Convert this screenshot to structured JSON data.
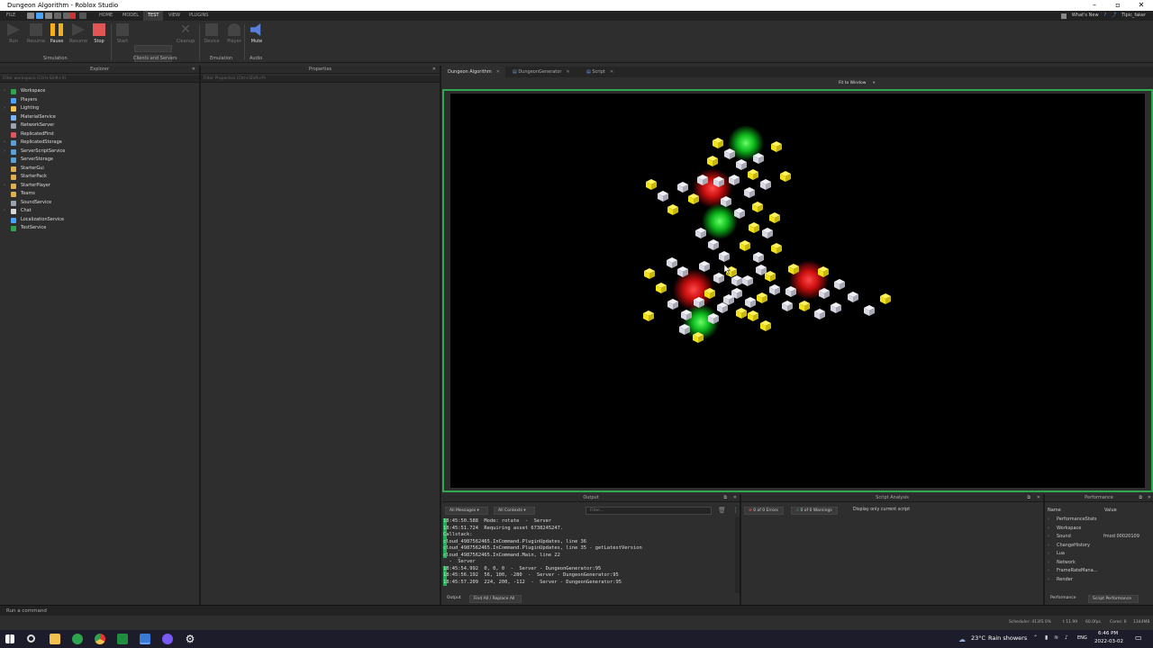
{
  "window": {
    "title": "Dungeon Algorithm - Roblox Studio"
  },
  "menu": {
    "file": "FILE",
    "home": "HOME",
    "model": "MODEL",
    "test": "TEST",
    "view": "VIEW",
    "plugins": "PLUGINS",
    "whats_new": "What's New",
    "user": "Tipic_faker"
  },
  "ribbon": {
    "run": "Run",
    "resume": "Resume",
    "pause": "Pause",
    "play": "Resume",
    "stop": "Stop",
    "start": "Start",
    "cleanup": "Cleanup",
    "device": "Device",
    "player": "Player",
    "mute": "Mute",
    "groups": {
      "simulation": "Simulation",
      "clients": "Clients and Servers",
      "emulation": "Emulation",
      "audio": "Audio"
    }
  },
  "explorer": {
    "title": "Explorer",
    "filter": "Filter workspace (Ctrl+Shift+X)",
    "items": [
      {
        "label": "Workspace",
        "icon": "globe-icon",
        "color": "#2da44e",
        "expand": true
      },
      {
        "label": "Players",
        "icon": "players-icon",
        "color": "#4aa3ff",
        "expand": false
      },
      {
        "label": "Lighting",
        "icon": "lightbulb-icon",
        "color": "#f2c14e",
        "expand": true
      },
      {
        "label": "MaterialService",
        "icon": "material-icon",
        "color": "#7ab6ff",
        "expand": false
      },
      {
        "label": "NetworkServer",
        "icon": "network-icon",
        "color": "#9aa4b1",
        "expand": false
      },
      {
        "label": "ReplicatedFirst",
        "icon": "replicated-first-icon",
        "color": "#e05561",
        "expand": false
      },
      {
        "label": "ReplicatedStorage",
        "icon": "replicated-storage-icon",
        "color": "#5aa0d8",
        "expand": true
      },
      {
        "label": "ServerScriptService",
        "icon": "server-script-icon",
        "color": "#5aa0d8",
        "expand": true
      },
      {
        "label": "ServerStorage",
        "icon": "server-storage-icon",
        "color": "#5aa0d8",
        "expand": false
      },
      {
        "label": "StarterGui",
        "icon": "starter-gui-icon",
        "color": "#e0b050",
        "expand": false
      },
      {
        "label": "StarterPack",
        "icon": "starter-pack-icon",
        "color": "#e0b050",
        "expand": false
      },
      {
        "label": "StarterPlayer",
        "icon": "starter-player-icon",
        "color": "#e0b050",
        "expand": true
      },
      {
        "label": "Teams",
        "icon": "teams-icon",
        "color": "#e0b050",
        "expand": false
      },
      {
        "label": "SoundService",
        "icon": "sound-icon",
        "color": "#9aa4b1",
        "expand": false
      },
      {
        "label": "Chat",
        "icon": "chat-icon",
        "color": "#d8d8d8",
        "expand": true
      },
      {
        "label": "LocalizationService",
        "icon": "localization-icon",
        "color": "#4aa3ff",
        "expand": false
      },
      {
        "label": "TestService",
        "icon": "test-icon",
        "color": "#2da44e",
        "expand": false
      }
    ]
  },
  "properties": {
    "title": "Properties",
    "filter": "Filter Properties (Ctrl+Shift+P)"
  },
  "tabs": [
    {
      "label": "Dungeon Algorithm",
      "icon": "place-icon"
    },
    {
      "label": "DungeonGenerator",
      "icon": "script-icon"
    },
    {
      "label": "Script",
      "icon": "script-icon"
    }
  ],
  "viewport_toolbar": {
    "fit": "Fit to Window"
  },
  "output": {
    "title": "Output",
    "filter_messages": "All Messages",
    "filter_contexts": "All Contexts",
    "filter_placeholder": "Filter...",
    "lines": [
      "18:45:50.588  Mode: rotate  -  Server",
      "18:45:51.724  Requiring asset 6738245247.",
      "Callstack:",
      "cloud_4987562465.InCommand.PluginUpdates, line 36",
      "cloud_4987562465.InCommand.PluginUpdates, line 35 - getLatestVersion",
      "cloud_4987562465.InCommand.Main, line 22",
      "  -  Server",
      "18:45:54.992  0, 0, 0  -  Server - DungeonGenerator:95",
      "18:45:56.192  56, 100, -280  -  Server - DungeonGenerator:95",
      "18:45:57.209  224, 200, -112  -  Server - DungeonGenerator:95"
    ],
    "tab_output": "Output",
    "tab_find": "Find All / Replace All"
  },
  "script_analysis": {
    "title": "Script Analysis",
    "errors": "0 of 0 Errors",
    "warnings": "0 of 0 Warnings",
    "option": "Display only current script"
  },
  "performance": {
    "title": "Performance",
    "col_name": "Name",
    "col_value": "Value",
    "rows": [
      {
        "name": "PerformanceStats",
        "value": ""
      },
      {
        "name": "Workspace",
        "value": ""
      },
      {
        "name": "Sound",
        "value": "fmod 00020109"
      },
      {
        "name": "ChangeHistory",
        "value": ""
      },
      {
        "name": "Lua",
        "value": ""
      },
      {
        "name": "Network",
        "value": ""
      },
      {
        "name": "FrameRateMana...",
        "value": ""
      },
      {
        "name": "Render",
        "value": ""
      }
    ],
    "tab_perf": "Performance",
    "tab_script": "Script Performance"
  },
  "command": {
    "placeholder": "Run a command"
  },
  "status": {
    "scheduler": "Scheduler: 413fS 0%",
    "t": "t 11.99",
    "fps": "60.0fps",
    "cores": "Cores: 6",
    "mem": "1344MB"
  },
  "taskbar": {
    "weather_temp": "23°C",
    "weather_text": "Rain showers",
    "lang": "ENG",
    "time": "6:46 PM",
    "date": "2022-03-02"
  },
  "colors": {
    "accent_green": "#2fa84f",
    "cube_yellow": "#f2e21a",
    "cube_grey": "#d9d9e3",
    "room_red": "#ff2020",
    "room_green": "#20ff40"
  }
}
